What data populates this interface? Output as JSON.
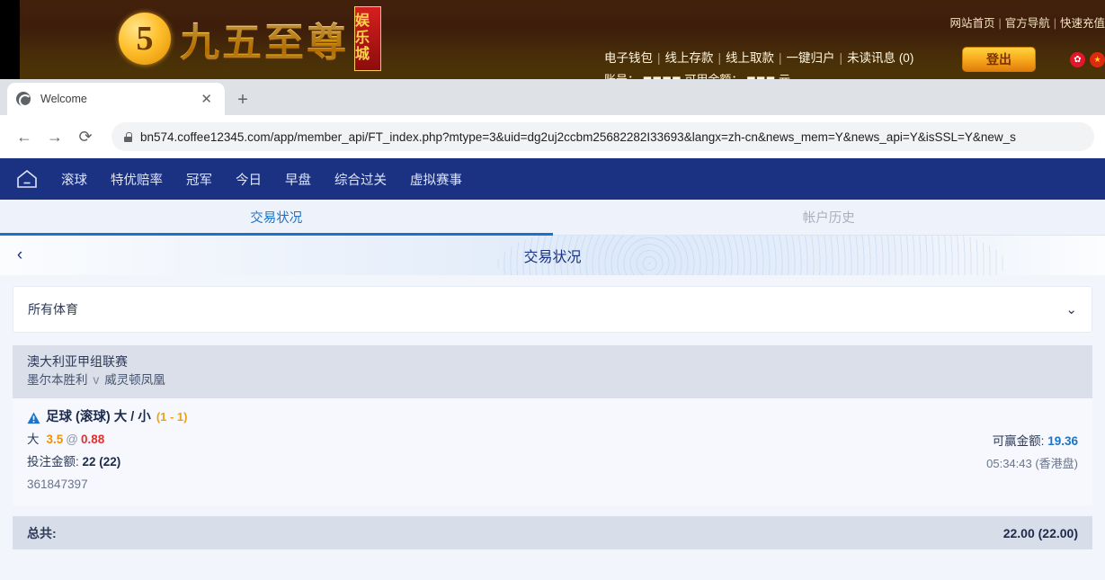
{
  "site": {
    "logo": {
      "mark": "5",
      "name": "九五至尊",
      "badge": "娱乐城"
    },
    "top_links": [
      "网站首页",
      "官方导航",
      "快速充值"
    ],
    "account_links": [
      "电子钱包",
      "线上存款",
      "线上取款",
      "一键归户",
      "未读讯息 (0)"
    ],
    "account_line2": "账号：  ◼◼◼◼        可用余额： ◼◼◼ 元",
    "logout_label": "登出",
    "flags": [
      "hong-kong-flag",
      "china-flag",
      "usa-flag"
    ],
    "separator": "|"
  },
  "browser": {
    "tab": {
      "title": "Welcome",
      "close_label": "✕",
      "favicon": "globe-icon"
    },
    "new_tab_label": "+",
    "back_label": "←",
    "forward_label": "→",
    "reload_label": "⟳",
    "url": "bn574.coffee12345.com/app/member_api/FT_index.php?mtype=3&uid=dg2uj2ccbm25682282I33693&langx=zh-cn&news_mem=Y&news_api=Y&isSSL=Y&new_s"
  },
  "nav": {
    "home_icon": "home-icon",
    "items": [
      "滚球",
      "特优赔率",
      "冠军",
      "今日",
      "早盘",
      "综合过关",
      "虚拟赛事"
    ]
  },
  "tabs": [
    {
      "label": "交易状况",
      "state": "active"
    },
    {
      "label": "帐户历史",
      "state": "inactive"
    }
  ],
  "page_header": {
    "back_icon": "chevron-left-icon",
    "title": "交易状况"
  },
  "filter": {
    "value": "所有体育",
    "chevron": "chevron-down-icon"
  },
  "bets": [
    {
      "league": "澳大利亚甲组联赛",
      "home_team": "墨尔本胜利",
      "vs": "v",
      "away_team": "威灵顿凤凰",
      "bet_type": "足球 (滚球) 大 / 小",
      "score": "(1 - 1)",
      "pick": "大",
      "handicap": "3.5",
      "at": "@",
      "odds": "0.88",
      "stake_label": "投注金额:",
      "stake_value": "22 (22)",
      "ticket_id": "361847397",
      "win_label": "可赢金额:",
      "win_value": "19.36",
      "time": "05:34:43 (香港盘)"
    }
  ],
  "total": {
    "label": "总共:",
    "value": "22.00 (22.00)"
  },
  "colors": {
    "nav_bg": "#1b3282",
    "tab_active": "#1a73c8",
    "odds_red": "#e03030",
    "handicap_orange": "#f29100",
    "score_gold": "#e8a317",
    "win_blue": "#1a73c8"
  }
}
